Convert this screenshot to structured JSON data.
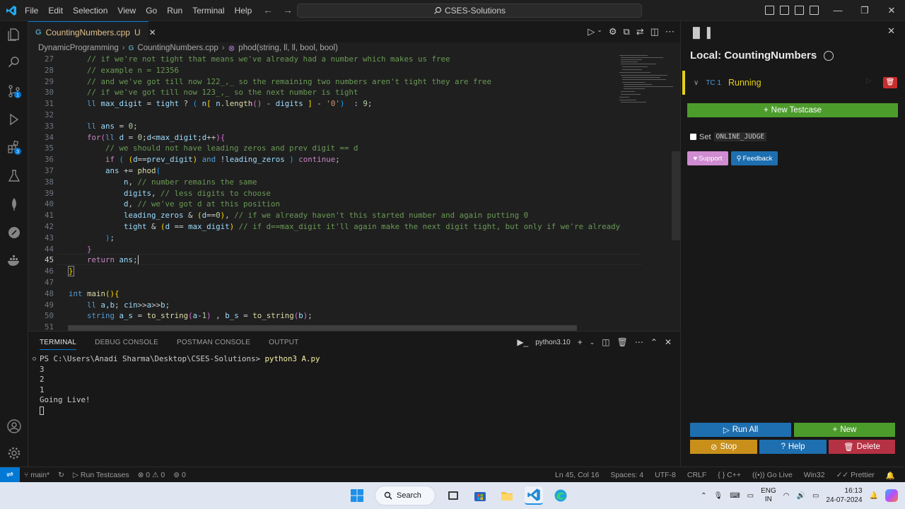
{
  "menu": [
    "File",
    "Edit",
    "Selection",
    "View",
    "Go",
    "Run",
    "Terminal",
    "Help"
  ],
  "command_center": "CSES-Solutions",
  "tab": {
    "icon_label": "C++",
    "name": "CountingNumbers.cpp",
    "modified": "U",
    "close": "✕"
  },
  "breadcrumb": {
    "folder": "DynamicProgramming",
    "file": "CountingNumbers.cpp",
    "symbol": "phod(string, ll, ll, bool, bool)"
  },
  "editor": {
    "cursor_line": "45",
    "line_numbers": [
      "27",
      "28",
      "29",
      "30",
      "31",
      "32",
      "33",
      "34",
      "35",
      "36",
      "37",
      "38",
      "39",
      "40",
      "41",
      "42",
      "43",
      "44",
      "45",
      "46",
      "47",
      "48",
      "49",
      "50",
      "51"
    ]
  },
  "panel": {
    "tabs": [
      "TERMINAL",
      "DEBUG CONSOLE",
      "POSTMAN CONSOLE",
      "OUTPUT"
    ],
    "shell": "python3.10",
    "prompt": "PS C:\\Users\\Anadi Sharma\\Desktop\\CSES-Solutions> ",
    "command": "python3 A.py",
    "output": [
      "3",
      "2",
      "1",
      "Going Live!"
    ]
  },
  "side": {
    "title": "Local: CountingNumbers",
    "testcase": {
      "label": "TC 1",
      "status": "Running"
    },
    "new_testcase": "New Testcase",
    "set_label": "Set",
    "online_judge": "ONLINE_JUDGE",
    "support": "Support",
    "feedback": "Feedback",
    "run_all": "Run All",
    "new": "New",
    "stop": "Stop",
    "help": "Help",
    "delete": "Delete"
  },
  "status": {
    "branch": "main*",
    "run_testcases": "Run Testcases",
    "problems": "0",
    "warnings": "0",
    "ports": "0",
    "position": "Ln 45, Col 16",
    "spaces": "Spaces: 4",
    "encoding": "UTF-8",
    "eol": "CRLF",
    "language": "C++",
    "go_live": "Go Live",
    "platform": "Win32",
    "prettier": "Prettier"
  },
  "taskbar": {
    "search": "Search",
    "lang_top": "ENG",
    "lang_bottom": "IN",
    "time": "16:13",
    "date": "24-07-2024"
  },
  "colors": {
    "accent": "#0078d4",
    "running": "#e4d115",
    "green": "#4c9c2c",
    "blue": "#1e6fb0",
    "red": "#c72e2e"
  }
}
